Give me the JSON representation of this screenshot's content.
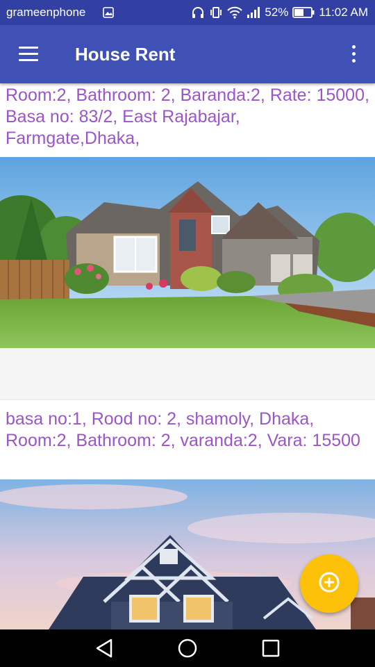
{
  "status_bar": {
    "carrier": "grameenphone",
    "battery": "52%",
    "time": "11:02 AM"
  },
  "app_bar": {
    "title": "House Rent",
    "menu_icon": "hamburger-menu-icon",
    "overflow_icon": "more-vert-icon"
  },
  "listings": [
    {
      "description": "Room:2, Bathroom: 2, Baranda:2, Rate: 15000, Basa no: 83/2, East Rajabajar, Farmgate,Dhaka,"
    },
    {
      "description": "basa no:1, Rood no: 2, shamoly, Dhaka, Room:2,  Bathroom: 2, varanda:2, Vara: 15500"
    }
  ],
  "fab": {
    "icon": "add-circle-icon"
  },
  "nav_bar": {
    "icons": [
      "back-triangle-icon",
      "home-circle-icon",
      "recents-square-icon"
    ]
  },
  "colors": {
    "status_bar": "#3140a2",
    "app_bar": "#3f51b5",
    "listing_text": "#9c55c8",
    "fab": "#fdc10a"
  }
}
